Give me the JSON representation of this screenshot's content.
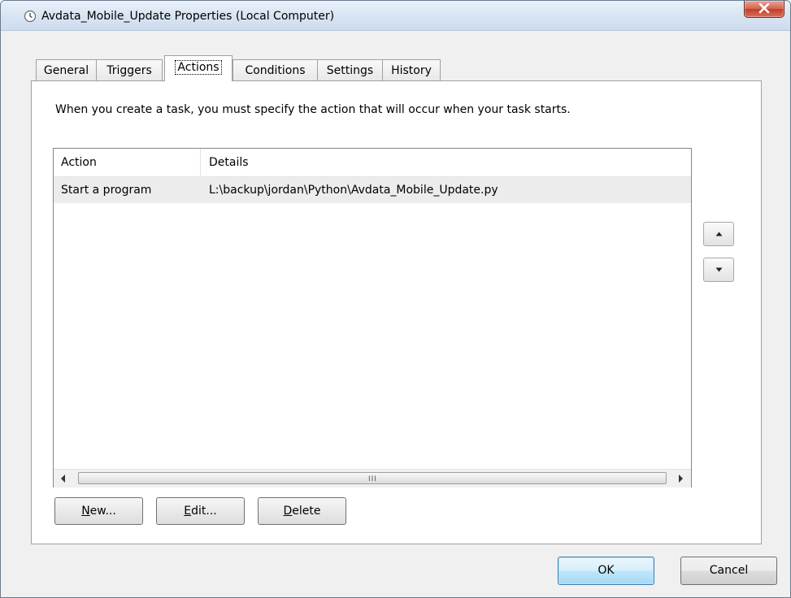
{
  "window": {
    "title": "Avdata_Mobile_Update Properties (Local Computer)",
    "title_icon": "clock-icon",
    "close_icon": "close-icon"
  },
  "tabs": [
    {
      "label": "General"
    },
    {
      "label": "Triggers"
    },
    {
      "label": "Actions",
      "active": true
    },
    {
      "label": "Conditions"
    },
    {
      "label": "Settings"
    },
    {
      "label": "History"
    }
  ],
  "actions_tab": {
    "description": "When you create a task, you must specify the action that will occur when your task starts.",
    "columns": [
      "Action",
      "Details"
    ],
    "rows": [
      {
        "action": "Start a program",
        "details": "L:\\backup\\jordan\\Python\\Avdata_Mobile_Update.py"
      }
    ],
    "scrollbar_grip": "III",
    "buttons": {
      "new_accel": "N",
      "new_rest": "ew...",
      "edit_accel": "E",
      "edit_rest": "dit...",
      "delete_accel": "D",
      "delete_rest": "elete"
    },
    "move_up_icon": "triangle-up-icon",
    "move_down_icon": "triangle-down-icon"
  },
  "footer": {
    "ok_label": "OK",
    "cancel_label": "Cancel"
  },
  "colors": {
    "ok_button_border": "#3c7fb1",
    "close_button": "#c23d28",
    "selected_row": "#ececec"
  }
}
